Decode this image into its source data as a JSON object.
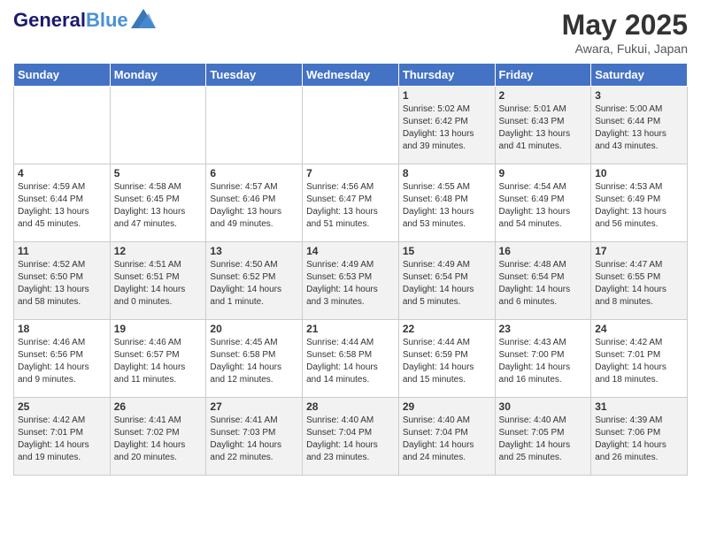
{
  "header": {
    "logo_general": "General",
    "logo_blue": "Blue",
    "month_year": "May 2025",
    "location": "Awara, Fukui, Japan"
  },
  "days_of_week": [
    "Sunday",
    "Monday",
    "Tuesday",
    "Wednesday",
    "Thursday",
    "Friday",
    "Saturday"
  ],
  "weeks": [
    [
      {
        "day": "",
        "info": ""
      },
      {
        "day": "",
        "info": ""
      },
      {
        "day": "",
        "info": ""
      },
      {
        "day": "",
        "info": ""
      },
      {
        "day": "1",
        "info": "Sunrise: 5:02 AM\nSunset: 6:42 PM\nDaylight: 13 hours\nand 39 minutes."
      },
      {
        "day": "2",
        "info": "Sunrise: 5:01 AM\nSunset: 6:43 PM\nDaylight: 13 hours\nand 41 minutes."
      },
      {
        "day": "3",
        "info": "Sunrise: 5:00 AM\nSunset: 6:44 PM\nDaylight: 13 hours\nand 43 minutes."
      }
    ],
    [
      {
        "day": "4",
        "info": "Sunrise: 4:59 AM\nSunset: 6:44 PM\nDaylight: 13 hours\nand 45 minutes."
      },
      {
        "day": "5",
        "info": "Sunrise: 4:58 AM\nSunset: 6:45 PM\nDaylight: 13 hours\nand 47 minutes."
      },
      {
        "day": "6",
        "info": "Sunrise: 4:57 AM\nSunset: 6:46 PM\nDaylight: 13 hours\nand 49 minutes."
      },
      {
        "day": "7",
        "info": "Sunrise: 4:56 AM\nSunset: 6:47 PM\nDaylight: 13 hours\nand 51 minutes."
      },
      {
        "day": "8",
        "info": "Sunrise: 4:55 AM\nSunset: 6:48 PM\nDaylight: 13 hours\nand 53 minutes."
      },
      {
        "day": "9",
        "info": "Sunrise: 4:54 AM\nSunset: 6:49 PM\nDaylight: 13 hours\nand 54 minutes."
      },
      {
        "day": "10",
        "info": "Sunrise: 4:53 AM\nSunset: 6:49 PM\nDaylight: 13 hours\nand 56 minutes."
      }
    ],
    [
      {
        "day": "11",
        "info": "Sunrise: 4:52 AM\nSunset: 6:50 PM\nDaylight: 13 hours\nand 58 minutes."
      },
      {
        "day": "12",
        "info": "Sunrise: 4:51 AM\nSunset: 6:51 PM\nDaylight: 14 hours\nand 0 minutes."
      },
      {
        "day": "13",
        "info": "Sunrise: 4:50 AM\nSunset: 6:52 PM\nDaylight: 14 hours\nand 1 minute."
      },
      {
        "day": "14",
        "info": "Sunrise: 4:49 AM\nSunset: 6:53 PM\nDaylight: 14 hours\nand 3 minutes."
      },
      {
        "day": "15",
        "info": "Sunrise: 4:49 AM\nSunset: 6:54 PM\nDaylight: 14 hours\nand 5 minutes."
      },
      {
        "day": "16",
        "info": "Sunrise: 4:48 AM\nSunset: 6:54 PM\nDaylight: 14 hours\nand 6 minutes."
      },
      {
        "day": "17",
        "info": "Sunrise: 4:47 AM\nSunset: 6:55 PM\nDaylight: 14 hours\nand 8 minutes."
      }
    ],
    [
      {
        "day": "18",
        "info": "Sunrise: 4:46 AM\nSunset: 6:56 PM\nDaylight: 14 hours\nand 9 minutes."
      },
      {
        "day": "19",
        "info": "Sunrise: 4:46 AM\nSunset: 6:57 PM\nDaylight: 14 hours\nand 11 minutes."
      },
      {
        "day": "20",
        "info": "Sunrise: 4:45 AM\nSunset: 6:58 PM\nDaylight: 14 hours\nand 12 minutes."
      },
      {
        "day": "21",
        "info": "Sunrise: 4:44 AM\nSunset: 6:58 PM\nDaylight: 14 hours\nand 14 minutes."
      },
      {
        "day": "22",
        "info": "Sunrise: 4:44 AM\nSunset: 6:59 PM\nDaylight: 14 hours\nand 15 minutes."
      },
      {
        "day": "23",
        "info": "Sunrise: 4:43 AM\nSunset: 7:00 PM\nDaylight: 14 hours\nand 16 minutes."
      },
      {
        "day": "24",
        "info": "Sunrise: 4:42 AM\nSunset: 7:01 PM\nDaylight: 14 hours\nand 18 minutes."
      }
    ],
    [
      {
        "day": "25",
        "info": "Sunrise: 4:42 AM\nSunset: 7:01 PM\nDaylight: 14 hours\nand 19 minutes."
      },
      {
        "day": "26",
        "info": "Sunrise: 4:41 AM\nSunset: 7:02 PM\nDaylight: 14 hours\nand 20 minutes."
      },
      {
        "day": "27",
        "info": "Sunrise: 4:41 AM\nSunset: 7:03 PM\nDaylight: 14 hours\nand 22 minutes."
      },
      {
        "day": "28",
        "info": "Sunrise: 4:40 AM\nSunset: 7:04 PM\nDaylight: 14 hours\nand 23 minutes."
      },
      {
        "day": "29",
        "info": "Sunrise: 4:40 AM\nSunset: 7:04 PM\nDaylight: 14 hours\nand 24 minutes."
      },
      {
        "day": "30",
        "info": "Sunrise: 4:40 AM\nSunset: 7:05 PM\nDaylight: 14 hours\nand 25 minutes."
      },
      {
        "day": "31",
        "info": "Sunrise: 4:39 AM\nSunset: 7:06 PM\nDaylight: 14 hours\nand 26 minutes."
      }
    ]
  ]
}
